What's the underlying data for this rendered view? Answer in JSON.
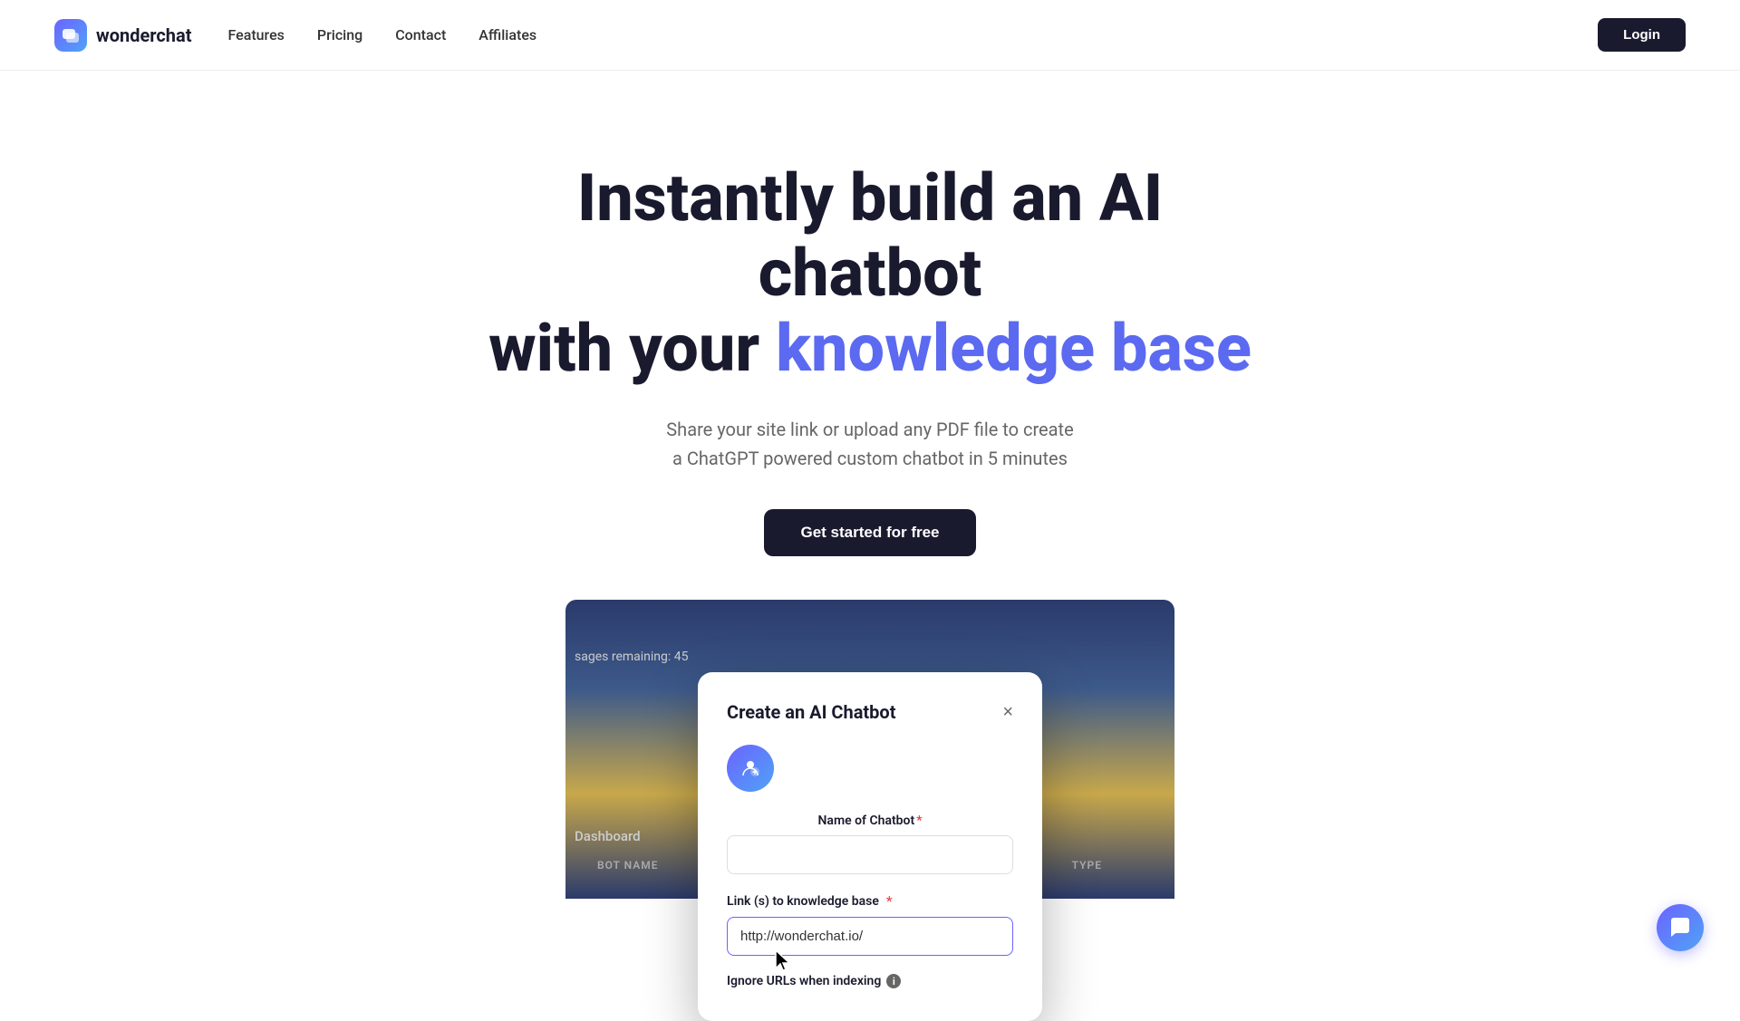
{
  "nav": {
    "logo_text": "wonderchat",
    "links": [
      {
        "label": "Features",
        "id": "features"
      },
      {
        "label": "Pricing",
        "id": "pricing"
      },
      {
        "label": "Contact",
        "id": "contact"
      },
      {
        "label": "Affiliates",
        "id": "affiliates"
      }
    ],
    "login_label": "Login"
  },
  "hero": {
    "title_line1": "Instantly build an AI chatbot",
    "title_line2_plain": "with your ",
    "title_line2_highlight": "knowledge base",
    "subtitle_line1": "Share your site link or upload any PDF file to create",
    "subtitle_line2": "a ChatGPT powered custom chatbot in 5 minutes",
    "cta_label": "Get started for free"
  },
  "preview": {
    "messages_remaining": "sages remaining: 45",
    "dashboard_label": "Dashboard",
    "bot_name_col": "BOT NAME",
    "type_col": "TYPE"
  },
  "modal": {
    "title": "Create an AI Chatbot",
    "close_icon": "×",
    "chatbot_name_label": "Name of Chatbot",
    "required_marker": "*",
    "link_label": "Link (s) to knowledge base",
    "link_placeholder": "http://wonderchat.io/",
    "ignore_urls_label": "Ignore URLs when indexing",
    "info_icon_label": "i"
  },
  "chat_widget": {
    "icon": "💬"
  }
}
